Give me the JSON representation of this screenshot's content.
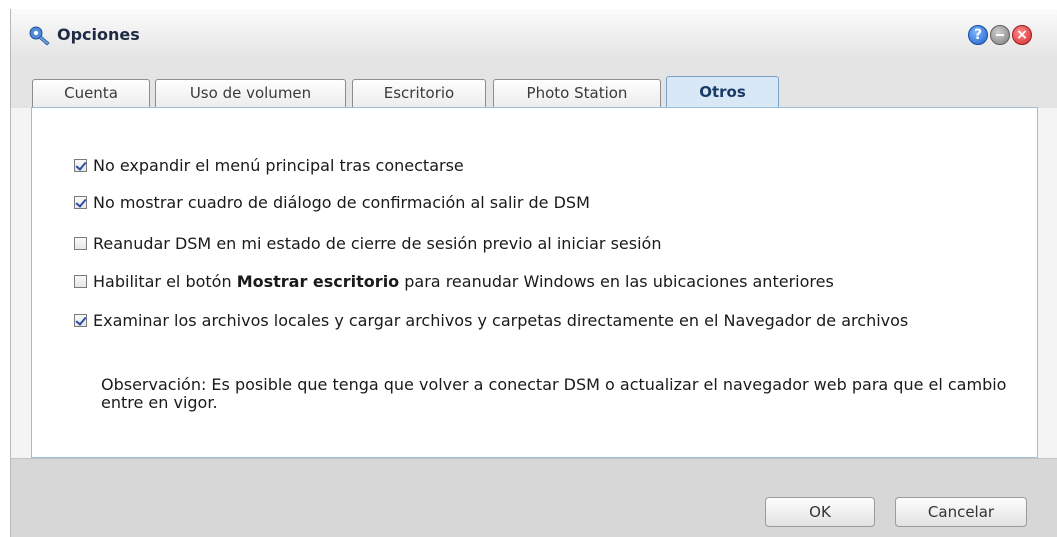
{
  "window": {
    "title": "Opciones"
  },
  "tabs": [
    {
      "label": "Cuenta",
      "active": false
    },
    {
      "label": "Uso de volumen",
      "active": false
    },
    {
      "label": "Escritorio",
      "active": false
    },
    {
      "label": "Photo Station",
      "active": false
    },
    {
      "label": "Otros",
      "active": true
    }
  ],
  "options": [
    {
      "label": "No expandir el menú principal tras conectarse",
      "checked": true
    },
    {
      "label": "No mostrar cuadro de diálogo de confirmación al salir de DSM",
      "checked": true
    },
    {
      "label": "Reanudar DSM en mi estado de cierre de sesión previo al iniciar sesión",
      "checked": false
    },
    {
      "label_before": "Habilitar el botón ",
      "label_bold": "Mostrar escritorio",
      "label_after": " para reanudar Windows en las ubicaciones anteriores",
      "checked": false
    },
    {
      "label": "Examinar los archivos locales y cargar archivos y carpetas directamente en el Navegador de archivos",
      "checked": true
    }
  ],
  "note": "Observación: Es posible que tenga que volver a conectar DSM o actualizar el navegador web para que el cambio entre en vigor.",
  "buttons": {
    "ok": "OK",
    "cancel": "Cancelar"
  },
  "icons": {
    "title": "options-icon",
    "help": "help-icon",
    "minimize": "minimize-icon",
    "close": "close-icon"
  },
  "colors": {
    "active_tab": "#d8e8f7",
    "check_mark": "#2b4fa3",
    "close_button": "#d12a2a",
    "help_button": "#1f5fcc"
  }
}
